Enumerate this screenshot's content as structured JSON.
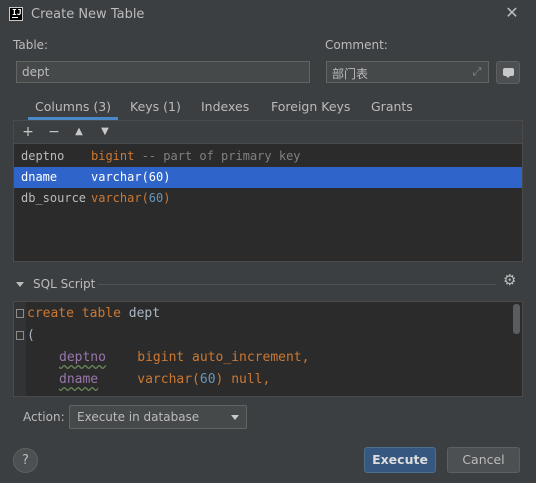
{
  "window": {
    "title": "Create New Table",
    "close_glyph": "✕"
  },
  "form": {
    "table_label": "Table:",
    "table_value": "dept",
    "comment_label": "Comment:",
    "comment_value": "部门表"
  },
  "tabs": [
    {
      "label": "Columns (3)",
      "active": true
    },
    {
      "label": "Keys (1)",
      "active": false
    },
    {
      "label": "Indexes",
      "active": false
    },
    {
      "label": "Foreign Keys",
      "active": false
    },
    {
      "label": "Grants",
      "active": false
    }
  ],
  "columns_toolbar": {
    "add": "+",
    "remove": "−",
    "up": "▲",
    "down": "▼"
  },
  "columns": [
    {
      "name": "deptno",
      "type_kw": "bigint",
      "type_num": "",
      "type_close": "",
      "comment": " -- part of primary key",
      "selected": false
    },
    {
      "name": "dname",
      "type_kw": "varchar(",
      "type_num": "60",
      "type_close": ")",
      "comment": "",
      "selected": true
    },
    {
      "name": "db_source",
      "type_kw": "varchar(",
      "type_num": "60",
      "type_close": ")",
      "comment": "",
      "selected": false
    }
  ],
  "sql": {
    "section_label": "SQL Script",
    "line1_kw": "create table",
    "line1_name": " dept",
    "line2": "(",
    "line3_col": "deptno",
    "line3_rest": "    bigint auto_increment,",
    "line4_col": "dname",
    "line4_pre": "     varchar(",
    "line4_num": "60",
    "line4_post": ") null,"
  },
  "action": {
    "label": "Action:",
    "selected": "Execute in database"
  },
  "buttons": {
    "execute": "Execute",
    "cancel": "Cancel",
    "help": "?"
  },
  "colors": {
    "accent": "#4a88c7",
    "selection": "#2f65ca",
    "primary_button": "#365880"
  }
}
